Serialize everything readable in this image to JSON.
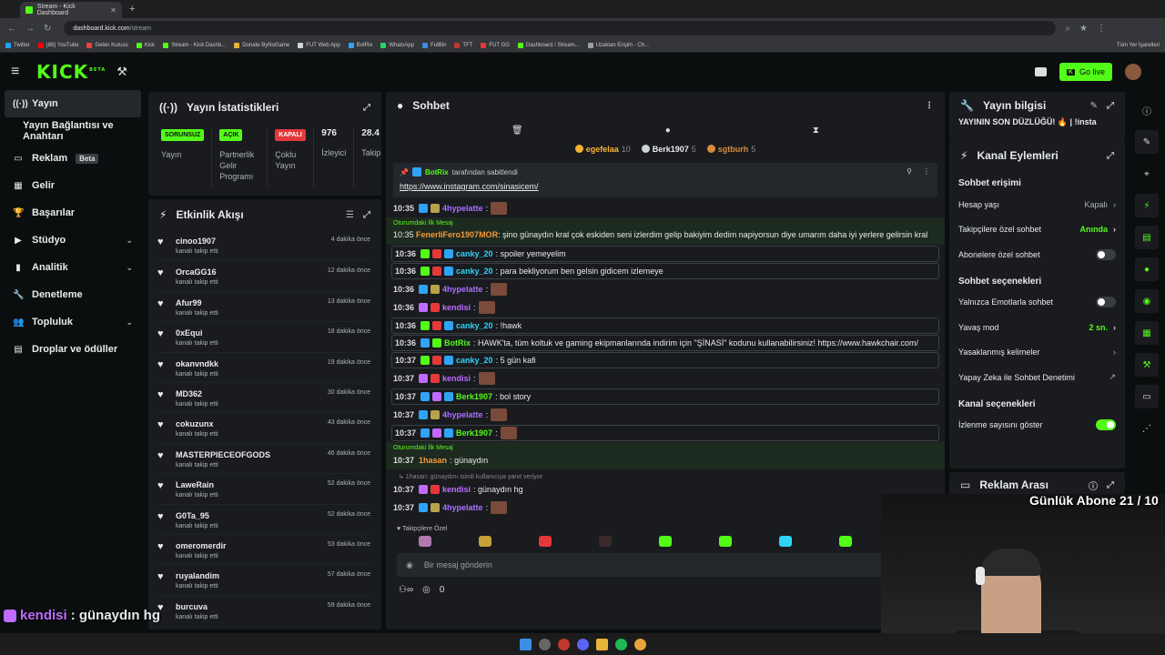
{
  "browser": {
    "tab_title": "Stream - Kick Dashboard",
    "url_host": "dashboard.kick.com",
    "url_path": "/stream",
    "bookmarks": [
      "Twitter",
      "(88) YouTube",
      "Gelen Kutusu",
      "Kick",
      "Stream - Kick Dashb...",
      "Donate ByNoGame",
      "FUT Web App",
      "BotRix",
      "WhatsApp",
      "FutBin",
      "TFT",
      "FUT GG",
      "Dashboard / Stream...",
      "Uzaktan Erişim - Ch..."
    ],
    "bookmarks_right": "Tüm Yer İşaretleri"
  },
  "header": {
    "logo": "KICK",
    "logo_beta": "BETA",
    "go_live": "Go live"
  },
  "sidebar": {
    "items": [
      {
        "label": "Yayın",
        "icon": "broadcast-icon",
        "active": true
      },
      {
        "label": "Yayın Bağlantısı ve Anahtarı",
        "icon": "",
        "sub": true
      },
      {
        "label": "Reklam",
        "icon": "tv-icon",
        "badge": "Beta"
      },
      {
        "label": "Gelir",
        "icon": "grid-icon"
      },
      {
        "label": "Başarılar",
        "icon": "trophy-icon"
      },
      {
        "label": "Stüdyo",
        "icon": "video-icon",
        "chevron": true
      },
      {
        "label": "Analitik",
        "icon": "chart-icon",
        "chevron": true
      },
      {
        "label": "Denetleme",
        "icon": "wrench-icon"
      },
      {
        "label": "Topluluk",
        "icon": "users-icon",
        "chevron": true
      },
      {
        "label": "Droplar ve ödüller",
        "icon": "gift-icon"
      }
    ]
  },
  "stats": {
    "title": "Yayın İstatistikleri",
    "items": [
      {
        "badge": "SORUNSUZ",
        "badge_color": "#53fc18",
        "label": "Yayın"
      },
      {
        "badge": "AÇIK",
        "badge_color": "#53fc18",
        "label": "Partnerlik Gelir Programı"
      },
      {
        "badge": "KAPALI",
        "badge_color": "#e5383b",
        "label": "Çoklu Yayın"
      },
      {
        "number": "976",
        "label": "İzleyici"
      },
      {
        "number": "28.4",
        "label": "Takip"
      }
    ]
  },
  "activity": {
    "title": "Etkinlik Akışı",
    "sub": "kanalı takip etti",
    "items": [
      {
        "name": "cinoo1907",
        "time": "4 dakika önce"
      },
      {
        "name": "OrcaGG16",
        "time": "12 dakika önce"
      },
      {
        "name": "Afur99",
        "time": "13 dakika önce"
      },
      {
        "name": "0xEqui",
        "time": "18 dakika önce"
      },
      {
        "name": "okanvndkk",
        "time": "19 dakika önce"
      },
      {
        "name": "MD362",
        "time": "30 dakika önce"
      },
      {
        "name": "cokuzunx",
        "time": "43 dakika önce"
      },
      {
        "name": "MASTERPIECEOFGODS",
        "time": "46 dakika önce"
      },
      {
        "name": "LaweRain",
        "time": "52 dakika önce"
      },
      {
        "name": "G0Ta_95",
        "time": "52 dakika önce"
      },
      {
        "name": "omeromerdir",
        "time": "53 dakika önce"
      },
      {
        "name": "ruyalandim",
        "time": "57 dakika önce"
      },
      {
        "name": "burcuva",
        "time": "59 dakika önce"
      }
    ]
  },
  "chat": {
    "title": "Sohbet",
    "gifters": [
      {
        "name": "egefelaa",
        "count": "10",
        "color": "#f5b335"
      },
      {
        "name": "Berk1907",
        "count": "5",
        "color": "#cfd3d6"
      },
      {
        "name": "sgtburh",
        "count": "5",
        "color": "#d98b3a"
      }
    ],
    "pinned_by": "BotRix",
    "pinned_suffix": "tarafından sabitlendi",
    "pinned_link": "https://www.instagram.com/sinasicem/",
    "first_msg_label": "Oturumdaki İlk Mesaj",
    "messages_top": [
      {
        "time": "10:35",
        "user": "4hypelatte",
        "color": "#a970ff",
        "text": ":",
        "emote": true
      }
    ],
    "first_msg_1": {
      "time": "10:35",
      "user": "FenerliFero1907MOR",
      "color": "#f59a3a",
      "text": "şino günaydın kral çok eskiden seni izlerdim gelip bakiyim dedim napiyorsun diye umarım daha iyi yerlere gelirsin kral"
    },
    "messages": [
      {
        "time": "10:36",
        "user": "canky_20",
        "color": "#2fd3f5",
        "text": ": spoiler yemeyelim",
        "hl": true
      },
      {
        "time": "10:36",
        "user": "canky_20",
        "color": "#2fd3f5",
        "text": ": para bekliyorum ben gelsin gidicem izlemeye",
        "hl": true
      },
      {
        "time": "10:36",
        "user": "4hypelatte",
        "color": "#a970ff",
        "text": ":",
        "emote": true
      },
      {
        "time": "10:36",
        "user": "kendisi",
        "color": "#c06bff",
        "text": ":",
        "emote": true
      },
      {
        "time": "10:36",
        "user": "canky_20",
        "color": "#2fd3f5",
        "text": ": !hawk",
        "hl": true
      },
      {
        "time": "10:36",
        "user": "BotRix",
        "color": "#53fc18",
        "text": ": HAWK'ta, tüm koltuk ve gaming ekipmanlarında indirim için \"ŞİNASİ\" kodunu kullanabilirsiniz! https://www.hawkchair.com/",
        "hl": true
      },
      {
        "time": "10:37",
        "user": "canky_20",
        "color": "#2fd3f5",
        "text": ": 5 gün kafi",
        "hl": true
      },
      {
        "time": "10:37",
        "user": "kendisi",
        "color": "#c06bff",
        "text": ":",
        "emote": true
      },
      {
        "time": "10:37",
        "user": "Berk1907",
        "color": "#53fc18",
        "text": ": bol story",
        "hl": true
      },
      {
        "time": "10:37",
        "user": "4hypelatte",
        "color": "#a970ff",
        "text": ":",
        "emote": true
      },
      {
        "time": "10:37",
        "user": "Berk1907",
        "color": "#53fc18",
        "text": ":",
        "emote": true,
        "hl": true
      }
    ],
    "first_msg_2": {
      "time": "10:37",
      "user": "1hasan",
      "color": "#f59a3a",
      "text": ": günaydın"
    },
    "reply_hint": "1hasan: günaydını isimli kullanıcıya yanıt veriyor",
    "messages_bottom": [
      {
        "time": "10:37",
        "user": "kendisi",
        "color": "#c06bff",
        "text": ": günaydın hg"
      },
      {
        "time": "10:37",
        "user": "4hypelatte",
        "color": "#a970ff",
        "text": ":",
        "emote": true
      }
    ],
    "followers_only": "Takipçilere Özel",
    "input_placeholder": "Bir mesaj gönderin",
    "points": "0"
  },
  "stream_info": {
    "title": "Yayın bilgisi",
    "text": "YAYININ SON DÜZLÜĞÜ! 🔥 | !insta"
  },
  "channel_actions": {
    "title": "Kanal Eylemleri",
    "chat_access": "Sohbet erişimi",
    "account_age_label": "Hesap yaşı",
    "account_age_value": "Kapalı",
    "followers_chat_label": "Takipçilere özel sohbet",
    "followers_chat_value": "Anında",
    "subs_chat_label": "Abonelere özel sohbet",
    "chat_options": "Sohbet seçenekleri",
    "emotes_only": "Yalnızca Emotlarla sohbet",
    "slow_mode_label": "Yavaş mod",
    "slow_mode_value": "2 sn.",
    "banned_words": "Yasaklanmış kelimeler",
    "ai_moderation": "Yapay Zeka ile Sohbet Denetimi",
    "channel_options": "Kanal seçenekleri",
    "show_views": "İzlenme sayısını göster"
  },
  "ad_break": {
    "title": "Reklam Arası"
  },
  "overlay": {
    "sub_goal": "Günlük Abone 21 / 10",
    "line1_user": "kendisi",
    "line1_text": " : günaydın hg",
    "line2_user": "4hypelatte",
    "line2_text": " :"
  }
}
